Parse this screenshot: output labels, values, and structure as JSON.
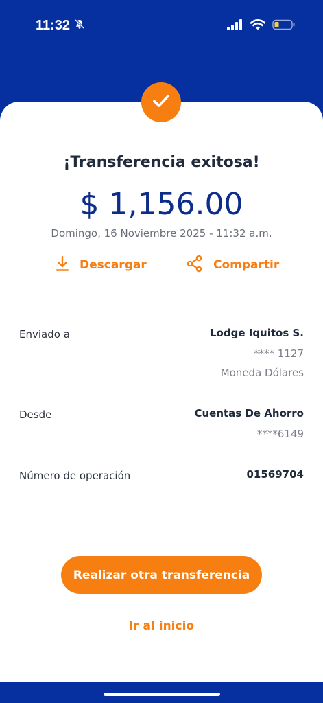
{
  "status_bar": {
    "time": "11:32"
  },
  "receipt": {
    "title": "¡Transferencia exitosa!",
    "amount": "$ 1,156.00",
    "datetime": "Domingo, 16 Noviembre 2025 - 11:32 a.m.",
    "actions": {
      "download_label": "Descargar",
      "share_label": "Compartir"
    }
  },
  "details": {
    "sent_to": {
      "label": "Enviado a",
      "name": "Lodge Iquitos S.",
      "account": "**** 1127",
      "currency": "Moneda Dólares"
    },
    "from": {
      "label": "Desde",
      "account_type": "Cuentas De Ahorro",
      "account": "****6149"
    },
    "operation": {
      "label": "Número de operación",
      "number": "01569704"
    }
  },
  "buttons": {
    "primary_label": "Realizar otra transferencia",
    "home_label": "Ir al inicio"
  },
  "colors": {
    "brand_blue": "#06309f",
    "accent_orange": "#f77f12"
  }
}
